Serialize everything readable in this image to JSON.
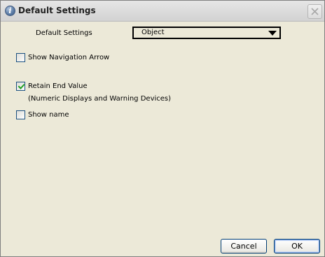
{
  "window": {
    "title": "Default Settings",
    "icon": "info-icon",
    "close_icon": "close-icon"
  },
  "form": {
    "default_settings_label": "Default Settings",
    "default_settings_value": "Object",
    "show_navigation_arrow": {
      "label": "Show Navigation Arrow",
      "checked": false
    },
    "retain_end_value": {
      "label": "Retain End Value",
      "note": "(Numeric Displays and Warning Devices)",
      "checked": true
    },
    "show_name": {
      "label": "Show name",
      "checked": false
    }
  },
  "buttons": {
    "cancel": "Cancel",
    "ok": "OK"
  },
  "colors": {
    "dialog_background": "#ECE9D8",
    "checkbox_border": "#1C5180",
    "checkmark": "#21A121",
    "button_border": "#003C74"
  }
}
